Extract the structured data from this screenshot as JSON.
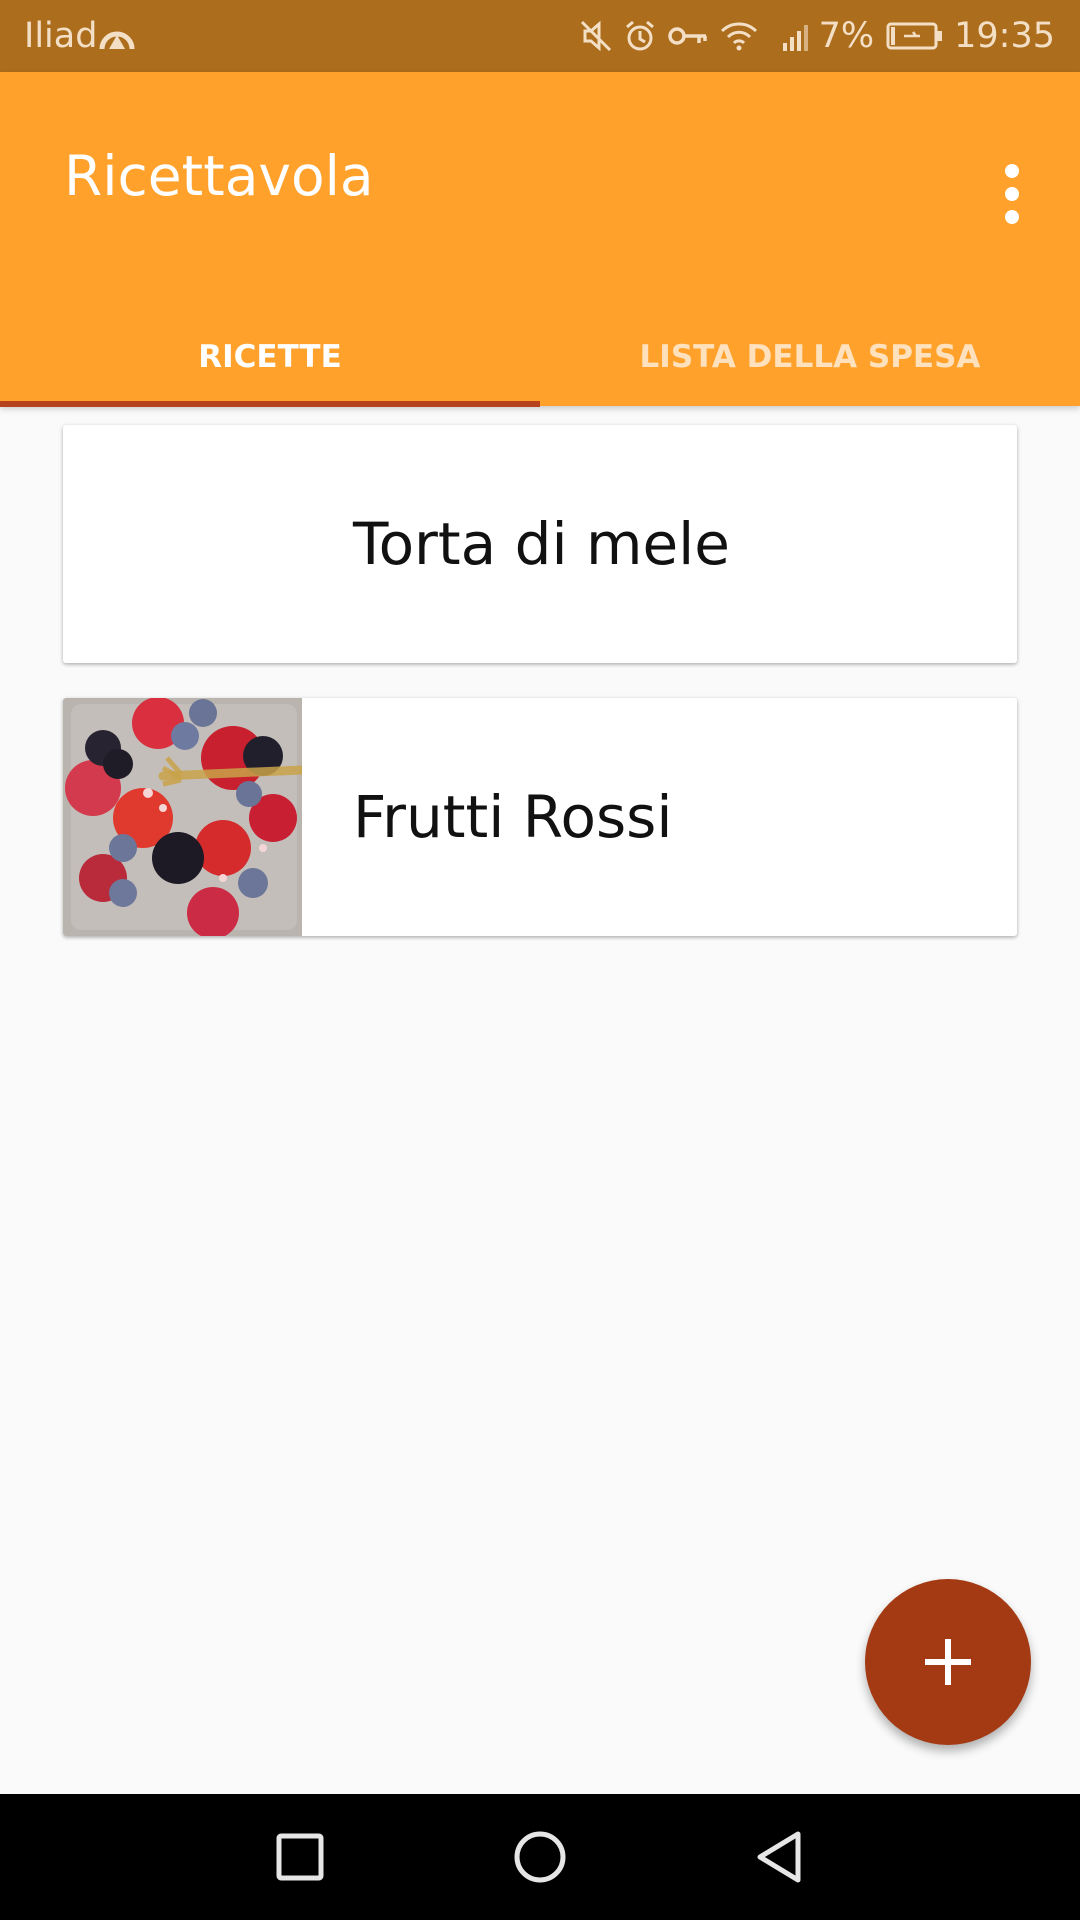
{
  "status_bar": {
    "carrier": "Iliad",
    "battery_percent": "7%",
    "time": "19:35",
    "icons": [
      "hotspot-icon",
      "mute-icon",
      "alarm-icon",
      "vpn-key-icon",
      "wifi-icon",
      "signal-icon",
      "battery-charging-icon"
    ]
  },
  "app_bar": {
    "title": "Ricettavola",
    "menu_icon": "more-vert-icon"
  },
  "tabs": [
    {
      "label": "RICETTE",
      "selected": true
    },
    {
      "label": "LISTA DELLA SPESA",
      "selected": false
    }
  ],
  "recipes": [
    {
      "name": "Torta di mele",
      "has_image": false
    },
    {
      "name": "Frutti Rossi",
      "has_image": true,
      "image_icon": "berries-photo"
    }
  ],
  "fab": {
    "icon": "plus-icon"
  },
  "nav_bar": {
    "icons": [
      "recents-icon",
      "home-icon",
      "back-icon"
    ]
  },
  "colors": {
    "status_bar": "#ac6d1c",
    "primary": "#ffa12b",
    "accent": "#a43a13",
    "tab_indicator": "#b6431e",
    "background": "#fafafa"
  }
}
